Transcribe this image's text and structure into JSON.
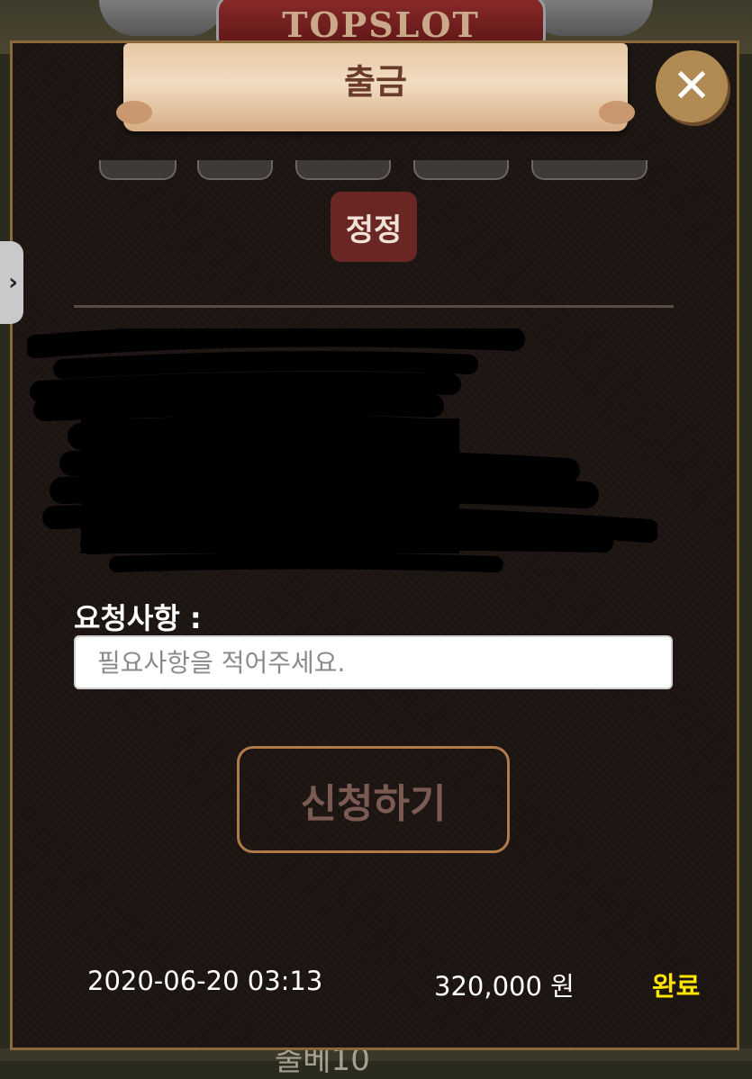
{
  "background": {
    "logo_text": "TOPSLOT",
    "bottom_text": "출베10 "
  },
  "modal": {
    "title": "출금",
    "close_label": "✕",
    "correct_label": "정정",
    "request_label": "요청사항 :",
    "request_placeholder": "필요사항을 적어주세요.",
    "submit_label": "신청하기"
  },
  "side_tab": {
    "label": "›"
  },
  "history": {
    "rows": [
      {
        "date": "2020-06-20 03:13",
        "amount": "320,000 원",
        "status": "완료"
      }
    ]
  },
  "colors": {
    "accent": "#b08a52",
    "correct_button": "#6a2622",
    "status_done": "#ffe400"
  }
}
